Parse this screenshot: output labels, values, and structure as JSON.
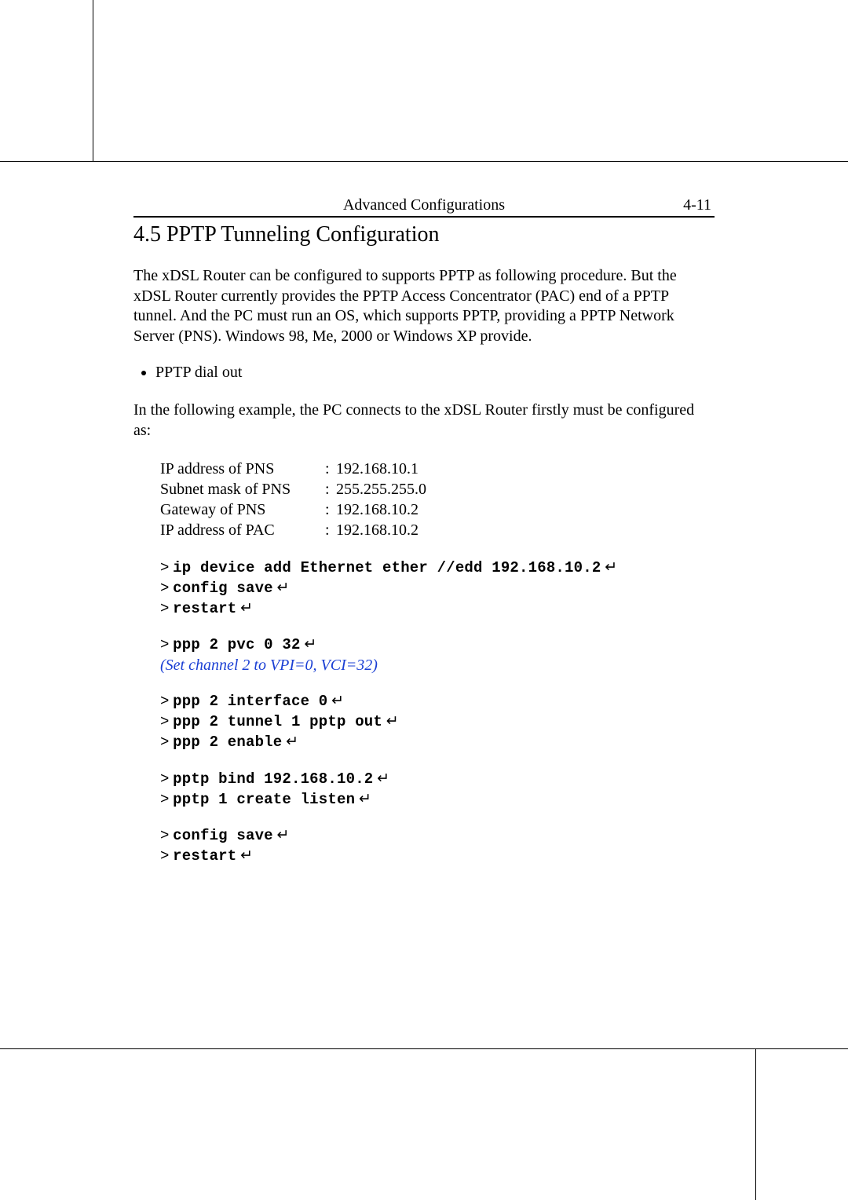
{
  "header": {
    "title": "Advanced Configurations",
    "page_number": "4-11"
  },
  "section_heading": "4.5 PPTP Tunneling Configuration",
  "intro_paragraph": "The xDSL Router can be configured to supports PPTP as following procedure. But the xDSL Router currently provides the PPTP Access Concentrator (PAC) end of a PPTP tunnel. And the PC must run an OS, which supports PPTP, providing a PPTP Network Server (PNS). Windows 98, Me, 2000 or Windows XP provide.",
  "bullet_item": "PPTP dial out",
  "example_intro": "In the following example, the PC connects to the xDSL Router firstly must be configured as:",
  "kv": {
    "ip_pns": {
      "label": "IP address of PNS",
      "colon": ":",
      "value": "192.168.10.1"
    },
    "mask_pns": {
      "label": "Subnet mask of PNS",
      "colon": ":",
      "value": "255.255.255.0"
    },
    "gw_pns": {
      "label": "Gateway of PNS",
      "colon": ":",
      "value": "192.168.10.2"
    },
    "ip_pac": {
      "label": "IP address of PAC",
      "colon": ":",
      "value": "192.168.10.2"
    }
  },
  "sym": {
    "gt": ">",
    "ret": "↵"
  },
  "cmd": {
    "c1": "ip device add Ethernet ether //edd 192.168.10.2",
    "c2": "config save",
    "c3": "restart",
    "c4": "ppp 2 pvc 0 32",
    "c5": "ppp 2 interface 0",
    "c6": "ppp 2 tunnel 1 pptp out",
    "c7": "ppp 2 enable",
    "c8": "pptp bind 192.168.10.2",
    "c9": "pptp 1 create listen",
    "c10": "config save",
    "c11": "restart"
  },
  "comment_line": "(Set channel 2 to VPI=0, VCI=32)"
}
